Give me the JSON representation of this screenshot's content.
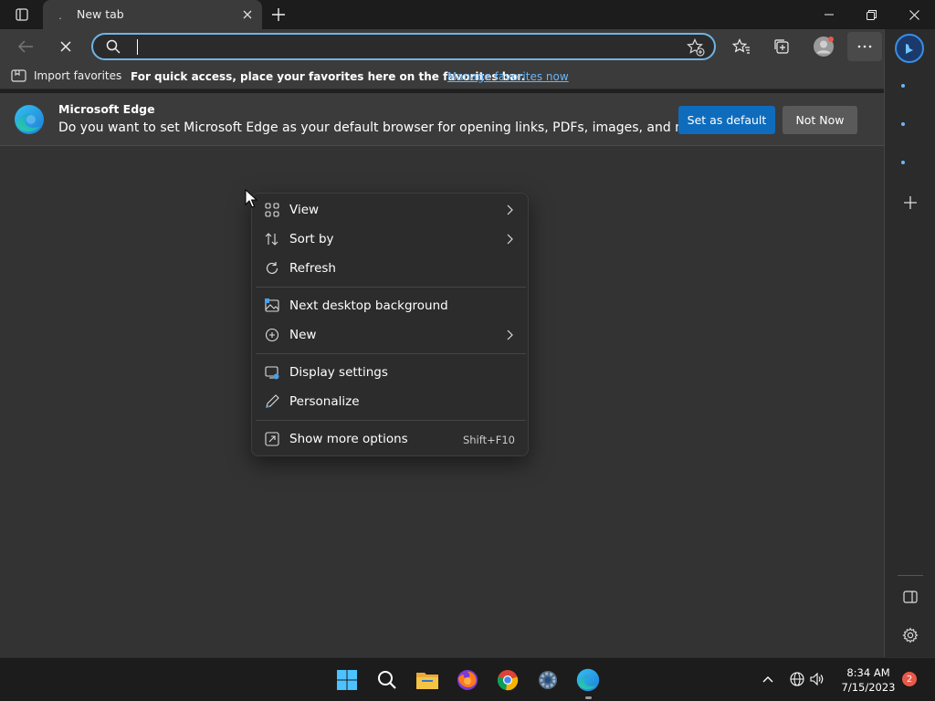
{
  "tab": {
    "title": "New tab"
  },
  "address": {
    "value": "",
    "placeholder": ""
  },
  "favorites_bar": {
    "import_label": "Import favorites",
    "message": "For quick access, place your favorites here on the favorites bar.",
    "manage_link": "Manage favorites now"
  },
  "infobar": {
    "title": "Microsoft Edge",
    "text": "Do you want to set Microsoft Edge as your default browser for opening links, PDFs, images, and more?",
    "set_default_label": "Set as default",
    "not_now_label": "Not Now"
  },
  "context_menu": {
    "items": [
      {
        "label": "View",
        "icon": "grid-icon",
        "submenu": true
      },
      {
        "label": "Sort by",
        "icon": "sort-icon",
        "submenu": true
      },
      {
        "label": "Refresh",
        "icon": "refresh-icon",
        "submenu": false
      },
      {
        "label": "Next desktop background",
        "icon": "desktop-background-icon",
        "submenu": false
      },
      {
        "label": "New",
        "icon": "plus-circle-icon",
        "submenu": true
      },
      {
        "label": "Display settings",
        "icon": "display-settings-icon",
        "submenu": false
      },
      {
        "label": "Personalize",
        "icon": "pen-icon",
        "submenu": false
      },
      {
        "label": "Show more options",
        "icon": "more-options-icon",
        "submenu": false,
        "shortcut": "Shift+F10"
      }
    ]
  },
  "taskbar": {
    "apps": [
      "start-icon",
      "search-icon",
      "file-explorer-icon",
      "firefox-icon",
      "chrome-icon",
      "settings-icon",
      "edge-icon"
    ],
    "clock_time": "8:34 AM",
    "clock_date": "7/15/2023",
    "notification_count": "2"
  },
  "colors": {
    "accent": "#0f6cbd",
    "address_border": "#6fb4e8",
    "link": "#6cb6f5",
    "menu_bg": "#2c2c2c",
    "content_bg": "#333333"
  }
}
